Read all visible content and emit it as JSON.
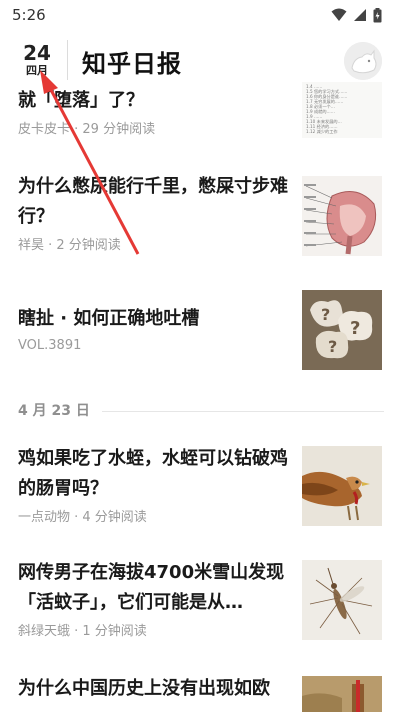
{
  "status_bar": {
    "time": "5:26"
  },
  "header": {
    "day": "24",
    "month": "四月",
    "title": "知乎日报"
  },
  "stories": [
    {
      "title": "就「堕落」了？",
      "meta": "皮卡皮卡 · 29 分钟阅读",
      "thumb_text": [
        "1.4  ……",
        "1.5  您的学习方式……",
        "1.6  你的身分是谁……",
        "1.7  无穷发展的……",
        "1.8  必须一个…",
        "1.9  成就的……",
        "1.9  ……",
        "1.10 未来发展的…",
        "1.11 经济的……",
        "1.12 减少的工作"
      ]
    },
    {
      "title": "为什么憋尿能行千里，憋屎寸步难行？",
      "meta": "祥昊 · 2 分钟阅读"
    },
    {
      "title": "瞎扯 · 如何正确地吐槽",
      "meta": "VOL.3891"
    }
  ],
  "section_label": "4 月 23 日",
  "stories_0423": [
    {
      "title": "鸡如果吃了水蛭，水蛭可以钻破鸡的肠胃吗？",
      "meta": "一点动物 · 4 分钟阅读"
    },
    {
      "title": "网传男子在海拔4700米雪山发现「活蚊子」，它们可能是从…",
      "meta": "斜绿天蛾 · 1 分钟阅读"
    },
    {
      "title": "为什么中国历史上没有出现如欧",
      "meta": ""
    }
  ],
  "colors": {
    "annotation_arrow": "#e53935",
    "meta_text": "#9a9a9a"
  }
}
